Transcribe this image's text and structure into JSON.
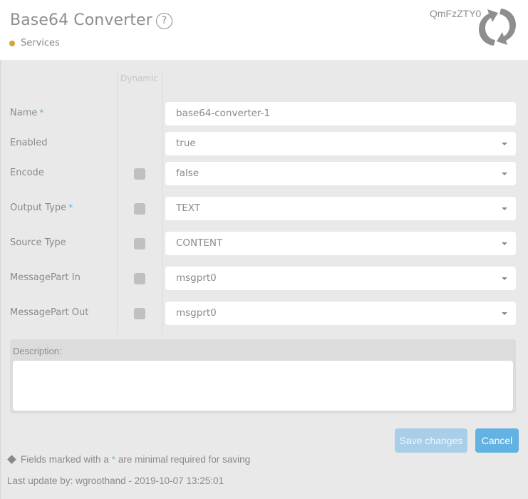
{
  "header": {
    "title": "Base64 Converter",
    "help_icon": "question-circle-icon",
    "breadcrumb": {
      "label": "Services",
      "dot_color": "#d4a437"
    },
    "encoded_title": "QmFzZTY0",
    "refresh_icon": "refresh-arrows-icon"
  },
  "form": {
    "dynamic_header": "Dynamic",
    "required_marker": "*",
    "rows": [
      {
        "label": "Name",
        "required": true,
        "dynamic": false,
        "type": "text",
        "value": "base64-converter-1"
      },
      {
        "label": "Enabled",
        "required": false,
        "dynamic": false,
        "type": "select",
        "value": "true"
      },
      {
        "label": "Encode",
        "required": false,
        "dynamic": true,
        "dynamic_checked": false,
        "type": "select",
        "value": "false"
      },
      {
        "label": "Output Type",
        "required": true,
        "dynamic": true,
        "dynamic_checked": false,
        "type": "select",
        "value": "TEXT"
      },
      {
        "label": "Source Type",
        "required": false,
        "dynamic": true,
        "dynamic_checked": false,
        "type": "select",
        "value": "CONTENT"
      },
      {
        "label": "MessagePart In",
        "required": false,
        "dynamic": true,
        "dynamic_checked": false,
        "type": "select",
        "value": "msgprt0"
      },
      {
        "label": "MessagePart Out",
        "required": false,
        "dynamic": true,
        "dynamic_checked": false,
        "type": "select",
        "value": "msgprt0"
      }
    ],
    "description": {
      "label": "Description:",
      "value": ""
    }
  },
  "actions": {
    "save_label": "Save changes",
    "save_disabled": true,
    "cancel_label": "Cancel",
    "accent_color": "#62b2e4"
  },
  "footer": {
    "note_prefix": "Fields marked with a",
    "note_marker": "*",
    "note_suffix": "are minimal required for saving",
    "last_update": "Last update by: wgroothand - 2019-10-07 13:25:01"
  }
}
